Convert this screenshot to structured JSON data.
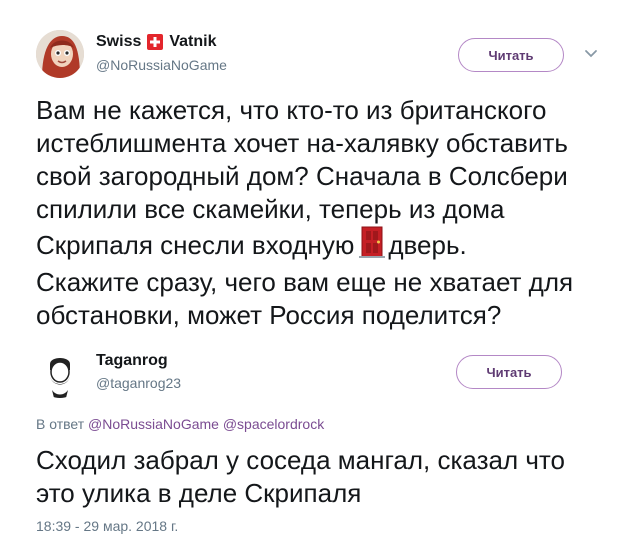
{
  "tweet1": {
    "author_name_part1": "Swiss",
    "author_name_part2": "Vatnik",
    "handle": "@NoRussiaNoGame",
    "follow_label": "Читать",
    "text_lines": [
      "Вам не кажется, что кто-то из британского",
      "истеблишмента хочет на-халявку обставить",
      "свой загородный дом? Сначала в Солсбери",
      "спилили все скамейки, теперь из дома",
      "Скрипаля снесли входную",
      "дверь.",
      "Скажите сразу, чего вам еще не хватает для",
      "обстановки, может Россия поделится?"
    ],
    "flag_icon": "swiss-flag-icon",
    "emoji_icon": "door-icon"
  },
  "tweet2": {
    "author_name": "Taganrog",
    "handle": "@taganrog23",
    "follow_label": "Читать",
    "reply_prefix": "В ответ",
    "reply_mentions": [
      "@NoRussiaNoGame",
      "@spacelordrock"
    ],
    "text_lines": [
      "Сходил забрал у соседа мангал, сказал что",
      "это улика в деле Скрипаля"
    ],
    "timestamp": "18:39 - 29 мар. 2018 г."
  },
  "colors": {
    "follow_border": "#b488c6",
    "follow_text": "#5f3b73",
    "mention": "#7b4c92",
    "secondary_text": "#657786",
    "swiss_red": "#e3262c"
  }
}
